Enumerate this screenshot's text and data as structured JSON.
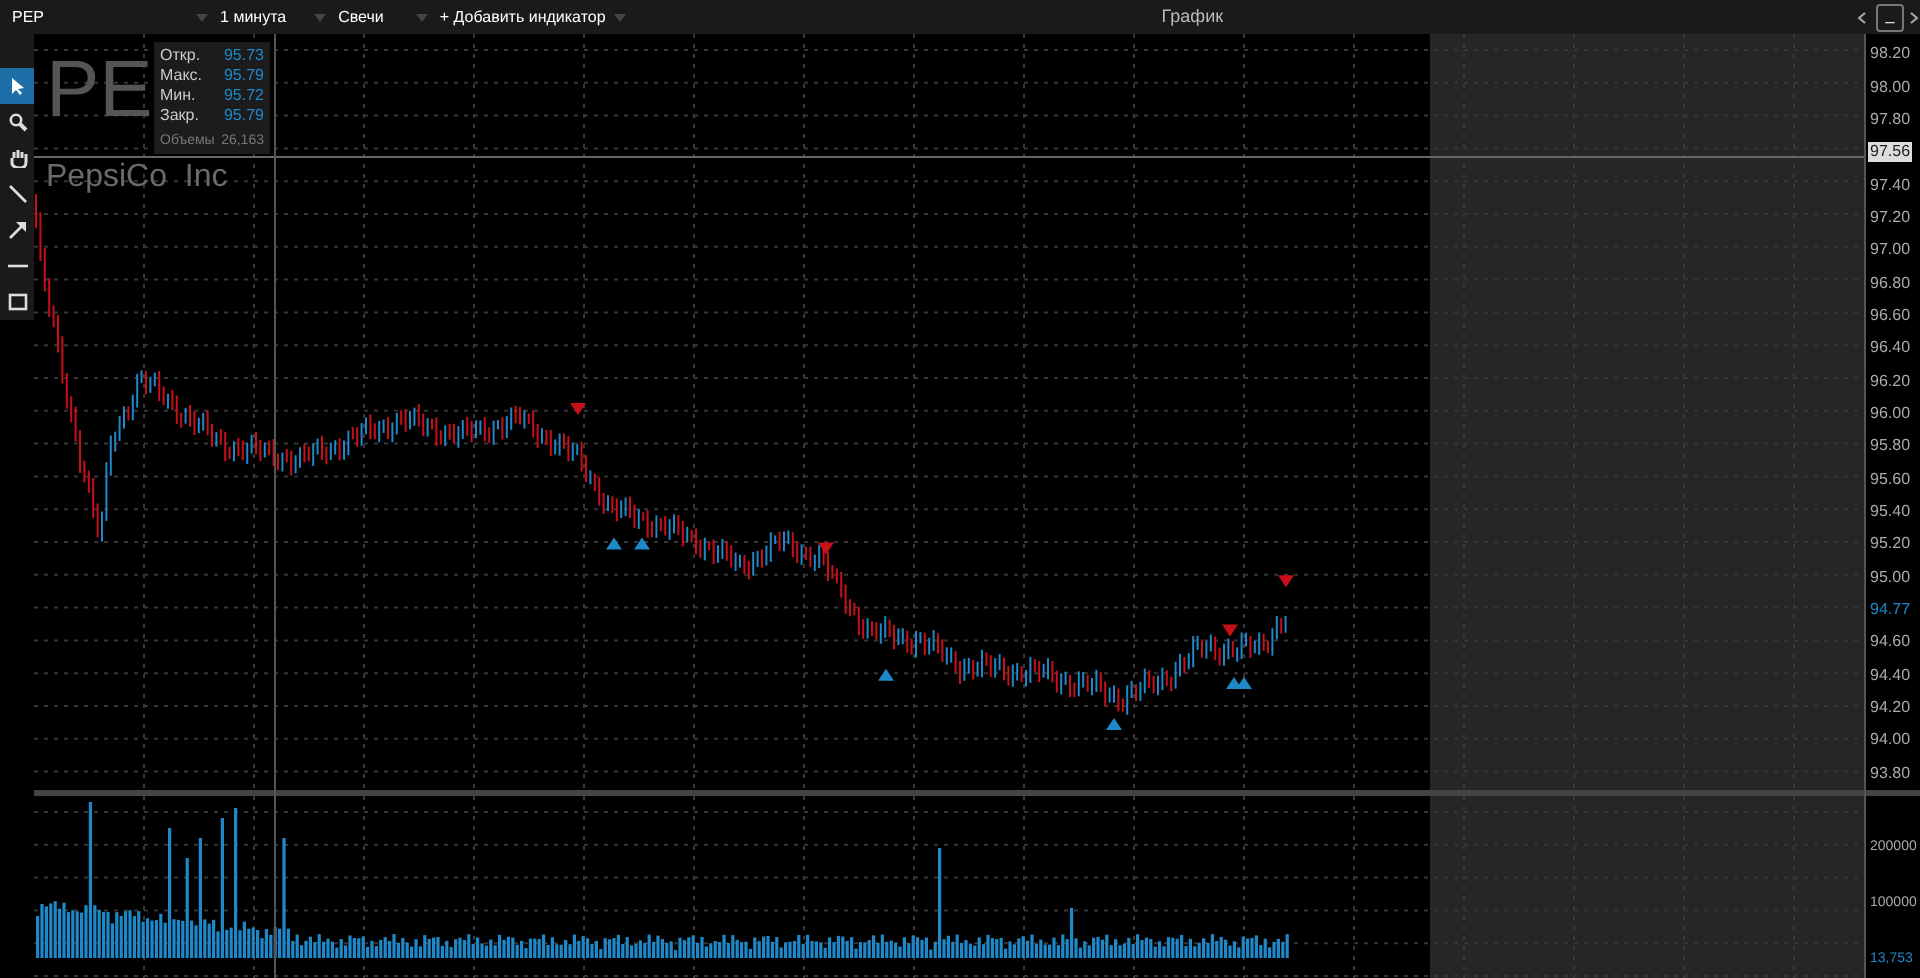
{
  "toolbar": {
    "symbol": "PEP",
    "interval": "1 минута",
    "chart_type": "Свечи",
    "add_indicator": "+ Добавить индикатор",
    "title": "График",
    "minimize": "_"
  },
  "tools": [
    {
      "kind": "pointer",
      "selected": true
    },
    {
      "kind": "zoom",
      "selected": false
    },
    {
      "kind": "hand",
      "selected": false
    },
    {
      "kind": "line",
      "selected": false
    },
    {
      "kind": "arrow",
      "selected": false
    },
    {
      "kind": "hline",
      "selected": false
    },
    {
      "kind": "rect",
      "selected": false
    }
  ],
  "legend": {
    "symbol": "PE",
    "company": "PepsiCo  Inc",
    "rows": [
      {
        "label": "Откр.",
        "value": "95.73"
      },
      {
        "label": "Макс.",
        "value": "95.79"
      },
      {
        "label": "Мин.",
        "value": "95.72"
      },
      {
        "label": "Закр.",
        "value": "95.79"
      }
    ],
    "volume_label": "Объемы",
    "volume_value": "26,163"
  },
  "price_axis": {
    "ticks": [
      {
        "kind": "tick",
        "label": "98.20"
      },
      {
        "kind": "tick",
        "label": "98.00"
      },
      {
        "kind": "tick",
        "label": "97.80"
      },
      {
        "kind": "crosshair",
        "label": "97.56"
      },
      {
        "kind": "tick",
        "label": "97.40"
      },
      {
        "kind": "tick",
        "label": "97.20"
      },
      {
        "kind": "tick",
        "label": "97.00"
      },
      {
        "kind": "tick",
        "label": "96.80"
      },
      {
        "kind": "tick",
        "label": "96.60"
      },
      {
        "kind": "tick",
        "label": "96.40"
      },
      {
        "kind": "tick",
        "label": "96.20"
      },
      {
        "kind": "tick",
        "label": "96.00"
      },
      {
        "kind": "tick",
        "label": "95.80"
      },
      {
        "kind": "tick",
        "label": "95.60"
      },
      {
        "kind": "tick",
        "label": "95.40"
      },
      {
        "kind": "tick",
        "label": "95.20"
      },
      {
        "kind": "tick",
        "label": "95.00"
      },
      {
        "kind": "last",
        "label": "94.77"
      },
      {
        "kind": "tick",
        "label": "94.60"
      },
      {
        "kind": "tick",
        "label": "94.40"
      },
      {
        "kind": "tick",
        "label": "94.20"
      },
      {
        "kind": "tick",
        "label": "94.00"
      },
      {
        "kind": "tick",
        "label": "93.80"
      }
    ]
  },
  "volume_axis": {
    "ticks": [
      "200000",
      "100000"
    ],
    "last_volume": "13,753"
  }
}
